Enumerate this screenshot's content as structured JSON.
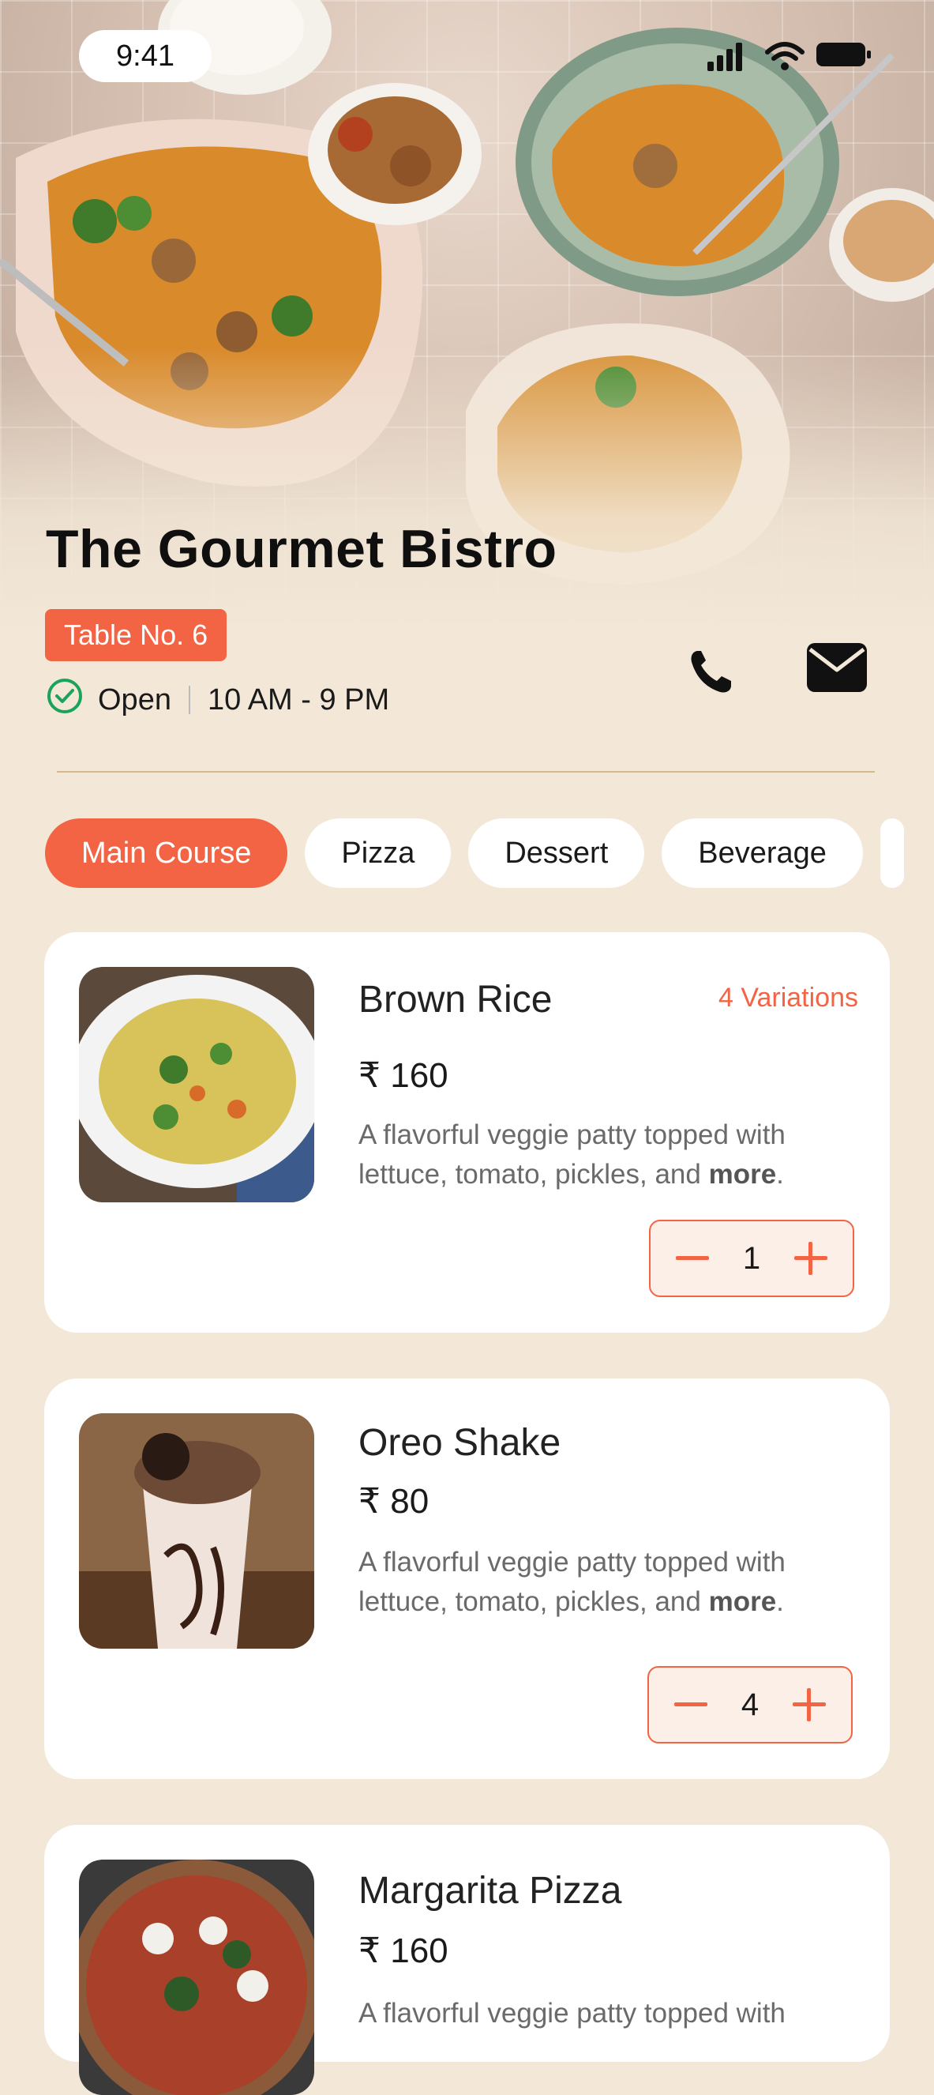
{
  "status_bar": {
    "time": "9:41",
    "icons": [
      "signal-icon",
      "wifi-icon",
      "battery-icon"
    ]
  },
  "restaurant": {
    "name": "The Gourmet Bistro",
    "table": "Table No. 6",
    "status": "Open",
    "hours": "10 AM - 9 PM"
  },
  "colors": {
    "accent": "#f26444",
    "background": "#f3e8d8",
    "card": "#ffffff",
    "open_green": "#1aa35a"
  },
  "categories": [
    {
      "label": "Main Course",
      "active": true
    },
    {
      "label": "Pizza",
      "active": false
    },
    {
      "label": "Dessert",
      "active": false
    },
    {
      "label": "Beverage",
      "active": false
    }
  ],
  "items": [
    {
      "name": "Brown Rice",
      "variations": "4 Variations",
      "price": "₹ 160",
      "desc": "A flavorful veggie patty topped with lettuce, tomato, pickles, and",
      "more": "more",
      "qty": "1"
    },
    {
      "name": "Oreo Shake",
      "price": "₹ 80",
      "desc": "A flavorful veggie patty topped with lettuce, tomato, pickles, and",
      "more": "more",
      "qty": "4"
    },
    {
      "name": "Margarita Pizza",
      "price": "₹ 160",
      "desc": "A flavorful veggie patty topped with"
    }
  ]
}
